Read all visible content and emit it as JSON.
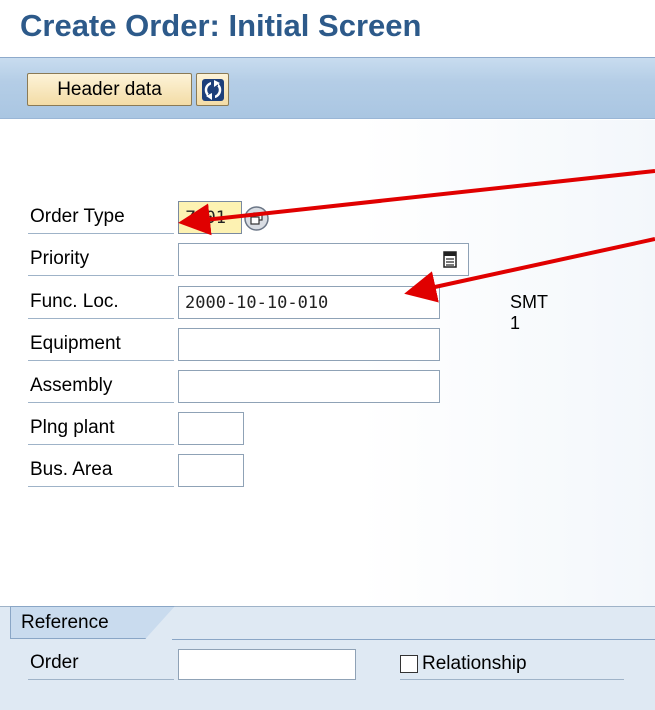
{
  "window": {
    "title": "Create Order: Initial Screen"
  },
  "toolbar": {
    "header_data_label": "Header data"
  },
  "form": {
    "order_type": {
      "label": "Order Type",
      "value": "Z001"
    },
    "priority": {
      "label": "Priority",
      "value": ""
    },
    "func_loc": {
      "label": "Func. Loc.",
      "value": "2000-10-10-010",
      "description": "SMT 1"
    },
    "equipment": {
      "label": "Equipment",
      "value": ""
    },
    "assembly": {
      "label": "Assembly",
      "value": ""
    },
    "plng_plant": {
      "label": "Plng plant",
      "value": ""
    },
    "bus_area": {
      "label": "Bus. Area",
      "value": ""
    }
  },
  "reference": {
    "tab_label": "Reference",
    "order_label": "Order",
    "order_value": "",
    "relationship_label": "Relationship",
    "relationship_checked": false
  },
  "colors": {
    "title": "#2d5a8a",
    "arrow": "#e00000",
    "toolbar": "#b4cde6",
    "button": "#f3dca6"
  }
}
